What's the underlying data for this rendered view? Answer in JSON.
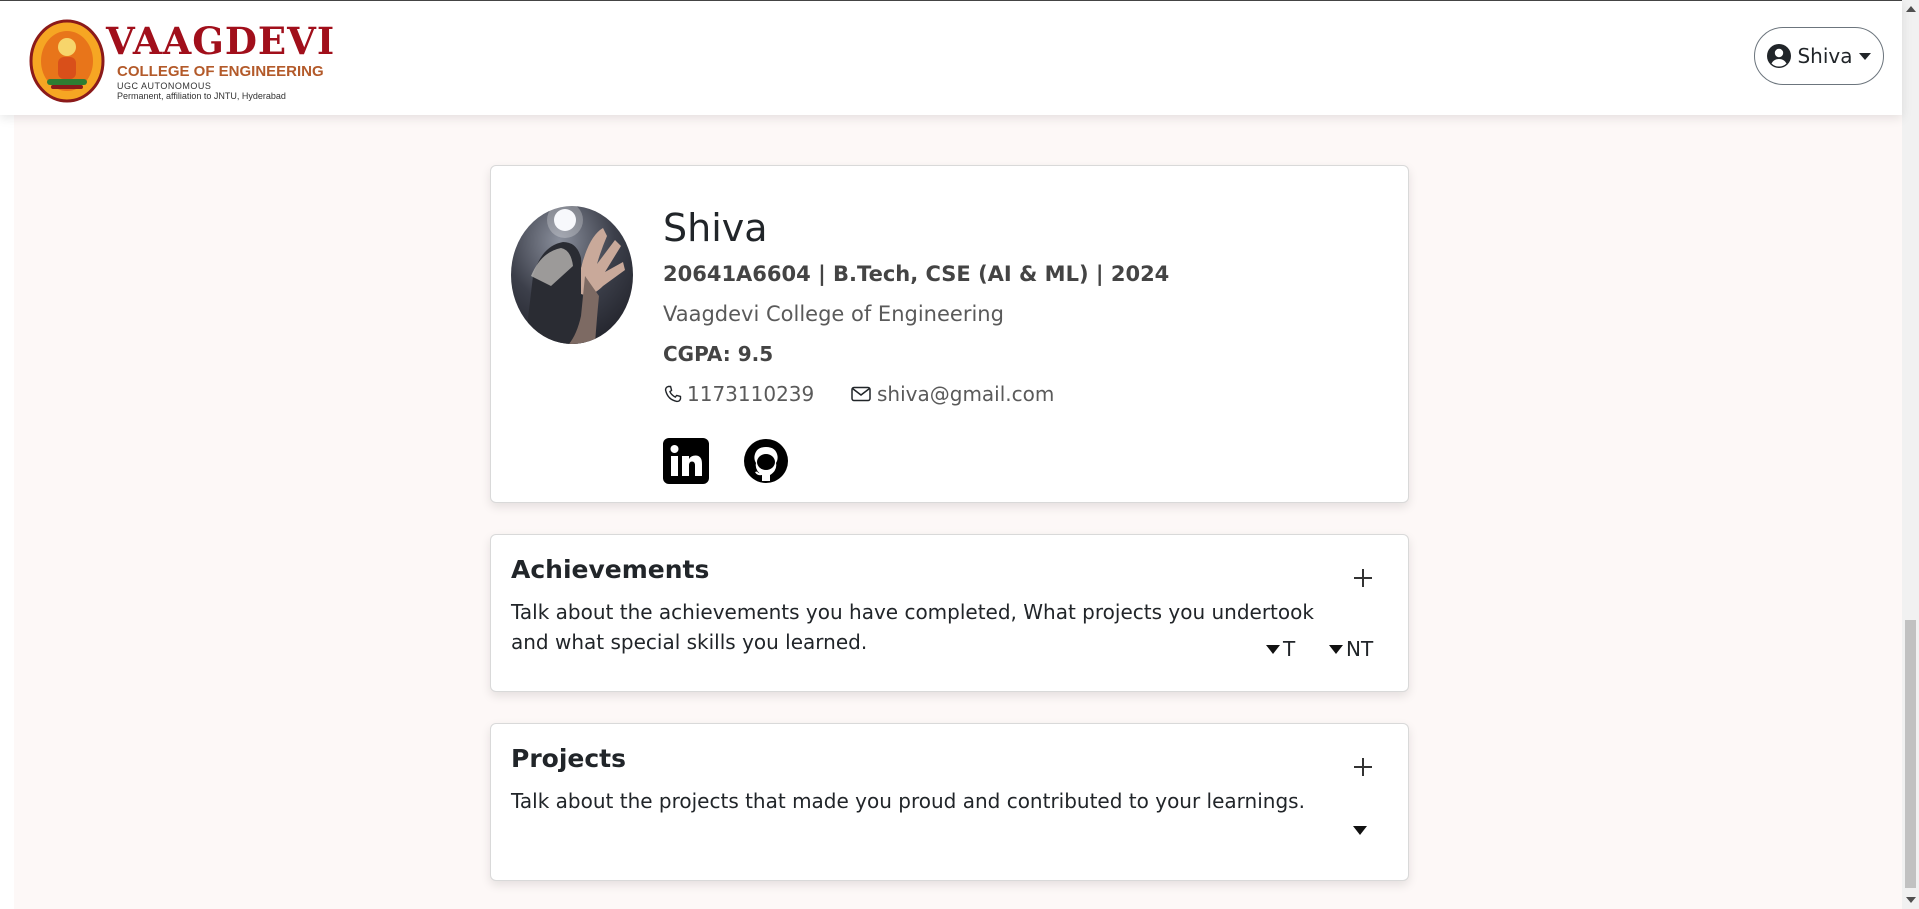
{
  "header": {
    "logo": {
      "seal_text": "VAAGDEVI COLLEGES",
      "title": "VAAGDEVI",
      "subtitle": "COLLEGE OF ENGINEERING",
      "autonomous": "UGC AUTONOMOUS",
      "affiliation": "Permanent, affiliation to JNTU, Hyderabad"
    },
    "user_menu": {
      "label": "Shiva",
      "icon": "person-circle-icon"
    }
  },
  "profile": {
    "name": "Shiva",
    "meta": "20641A6604 | B.Tech, CSE (AI & ML) | 2024",
    "college": "Vaagdevi College of Engineering",
    "cgpa": "CGPA: 9.5",
    "phone": "1173110239",
    "email": "shiva@gmail.com",
    "social": [
      {
        "name": "LinkedIn",
        "icon": "linkedin-icon"
      },
      {
        "name": "GitHub",
        "icon": "github-icon"
      }
    ]
  },
  "sections": {
    "achievements": {
      "title": "Achievements",
      "description": "Talk about the achievements you have completed, What projects you undertook and what special skills you learned.",
      "filters": [
        "T",
        "NT"
      ]
    },
    "projects": {
      "title": "Projects",
      "description": "Talk about the projects that made you proud and contributed to your learnings."
    }
  },
  "colors": {
    "brand_red": "#a10f1b",
    "brand_orange": "#b35a2a",
    "page_background": "#fdf8f7"
  }
}
